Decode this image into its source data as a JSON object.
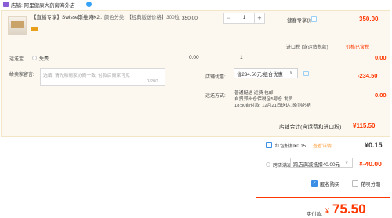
{
  "shop": {
    "label": "店铺: 阿里健康大药房海外店"
  },
  "item": {
    "title": "【直播专享】Swisse斯维诗K2...",
    "attr_label": "颜色分类:",
    "attr_value": "【经典版送价格】300粒",
    "unit_price": "350.00",
    "quantity": "1",
    "promo_label": "健客专享价",
    "subtotal": "350.00"
  },
  "tax": {
    "text": "进口税 (含运费税款)",
    "link": "价格已含税"
  },
  "shipping": {
    "label": "运送宝",
    "option": "免费",
    "price": "0.00",
    "qty": "1",
    "subtotal": "0.00"
  },
  "message": {
    "label": "给卖家留言:",
    "placeholder": "选填, 请先和商家协商一致, 付款后商家可见",
    "count": "0/200"
  },
  "discount": {
    "label": "店铺优惠:",
    "selected": "省234.50元:组合优惠",
    "amount": "-234.50"
  },
  "delivery": {
    "label": "运送方式:",
    "line1": "普通配送 运费 包邮",
    "line2": "自贸郑州仓保税区5号仓 发货",
    "line3": "18:30前付款, 12月21日送达, 晚到必赔",
    "amount": "0.00"
  },
  "shop_total": {
    "label": "店铺合计(含运费和进口税)",
    "value": "¥115.50"
  },
  "hongbao": {
    "text": "红包抵扣¥0.15",
    "link": "查看详情",
    "value": "¥0.15"
  },
  "cross_store": {
    "text": "跨店满减",
    "selected": "跨店满减抵扣40.00元",
    "value": "¥-40.00"
  },
  "options": {
    "anonymous": "匿名购买",
    "huabei": "花呗分期"
  },
  "payment": {
    "label": "实付款:",
    "currency": "¥",
    "value": "75.50"
  },
  "colors": {
    "accent": "#ff3700",
    "link_blue": "#3a8ee6",
    "panel_bg": "#fcf8ef"
  },
  "icons": {
    "shop": "shop-icon",
    "wangwang": "wangwang-icon"
  }
}
